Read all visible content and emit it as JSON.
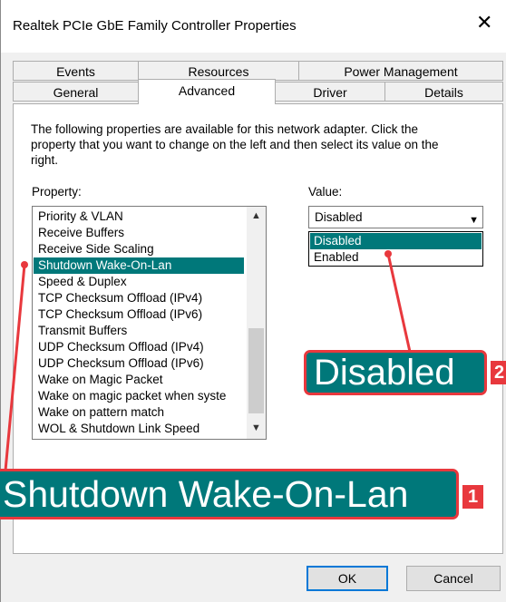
{
  "window": {
    "title": "Realtek PCIe GbE Family Controller Properties",
    "close_glyph": "✕"
  },
  "tabs": {
    "row1": [
      "Events",
      "Resources",
      "Power Management"
    ],
    "row2": [
      "General",
      "Advanced",
      "Driver",
      "Details"
    ],
    "active": "Advanced"
  },
  "description": "The following properties are available for this network adapter. Click the property that you want to change on the left and then select its value on the right.",
  "property_label": "Property:",
  "value_label": "Value:",
  "properties": [
    "Priority & VLAN",
    "Receive Buffers",
    "Receive Side Scaling",
    "Shutdown Wake-On-Lan",
    "Speed & Duplex",
    "TCP Checksum Offload (IPv4)",
    "TCP Checksum Offload (IPv6)",
    "Transmit Buffers",
    "UDP Checksum Offload (IPv4)",
    "UDP Checksum Offload (IPv6)",
    "Wake on Magic Packet",
    "Wake on magic packet when syste",
    "Wake on pattern match",
    "WOL & Shutdown Link Speed"
  ],
  "selected_property": "Shutdown Wake-On-Lan",
  "value_combo": {
    "current": "Disabled",
    "options": [
      "Disabled",
      "Enabled"
    ]
  },
  "buttons": {
    "ok": "OK",
    "cancel": "Cancel"
  },
  "callouts": [
    {
      "text": "Shutdown Wake-On-Lan",
      "badge": "1"
    },
    {
      "text": "Disabled",
      "badge": "2"
    }
  ],
  "colors": {
    "selection": "#00787a",
    "callout_border": "#e8383d",
    "default_button_border": "#0078d7"
  }
}
